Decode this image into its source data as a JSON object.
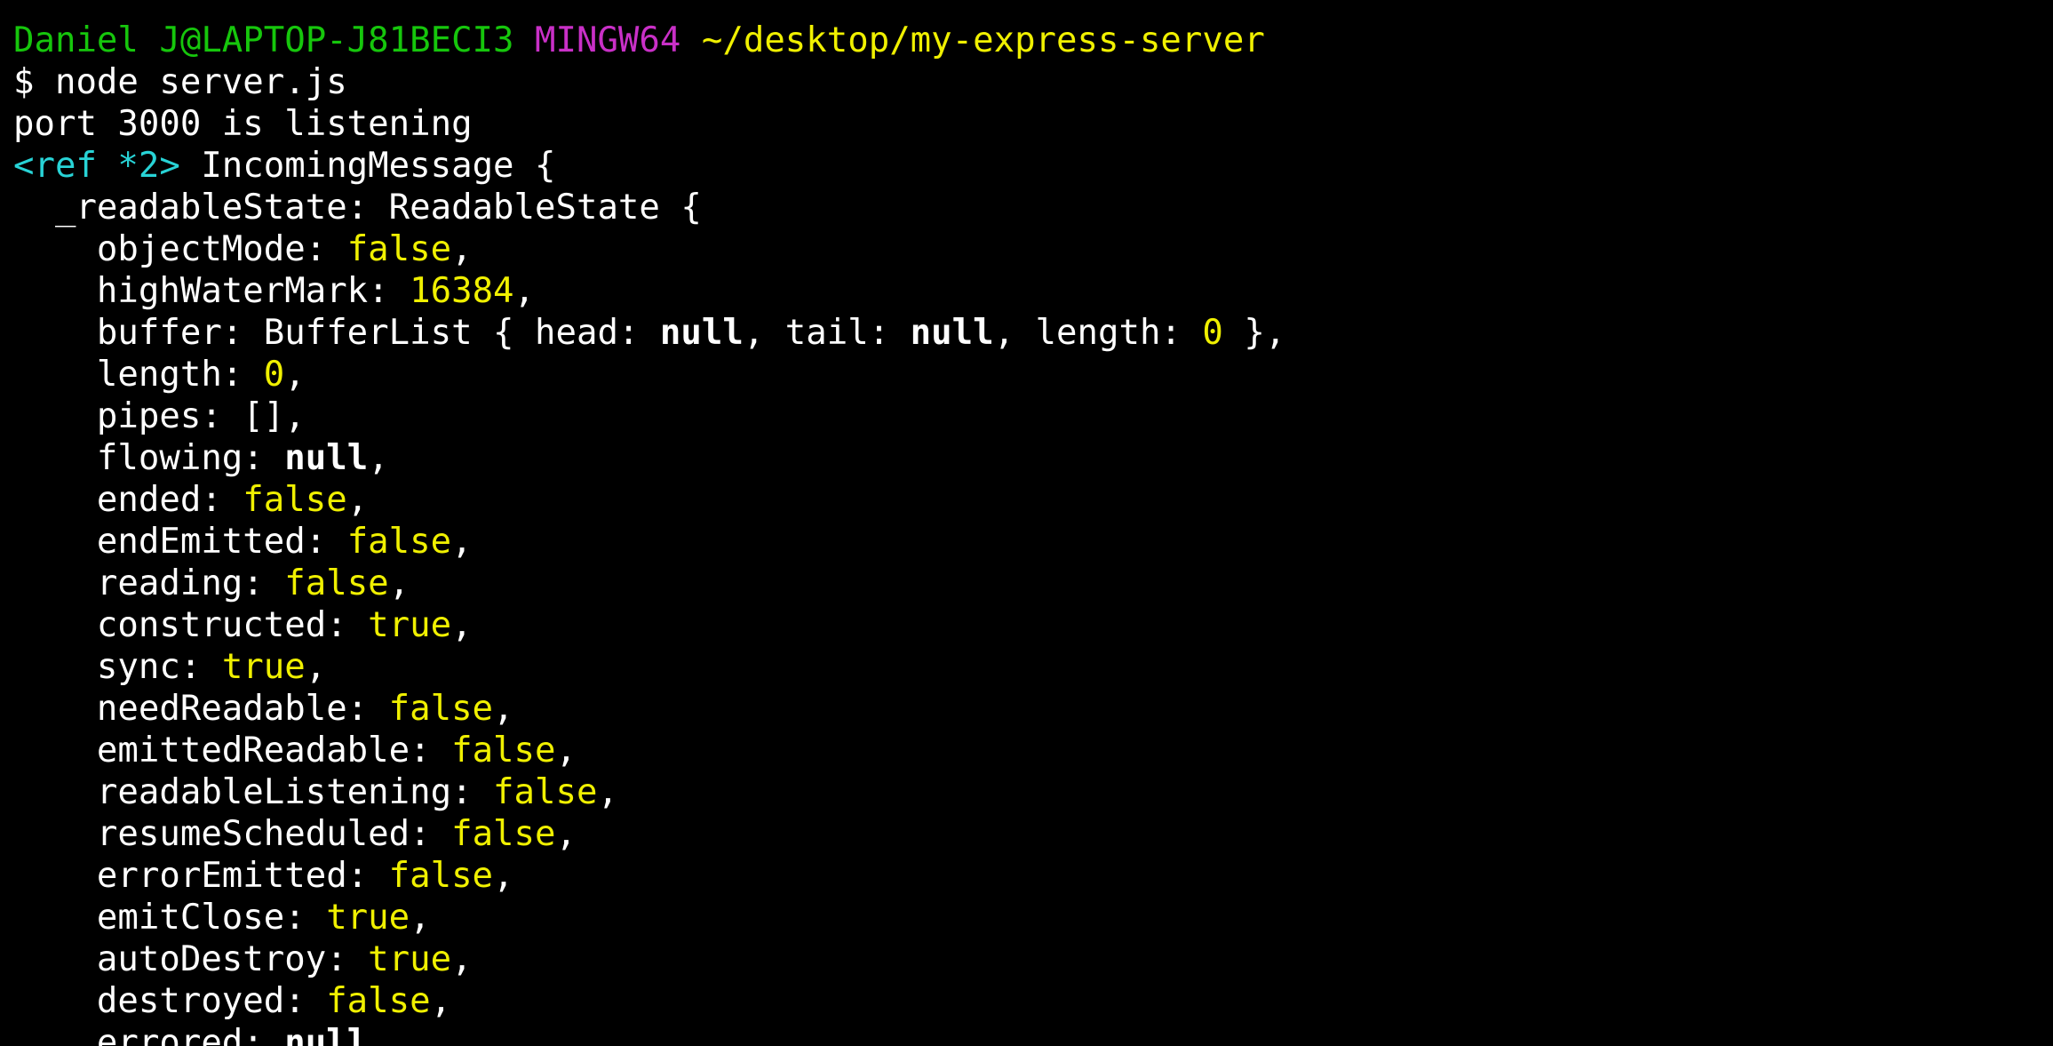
{
  "prompt": {
    "user": "Daniel J@LAPTOP-J81BECI3",
    "shell": "MINGW64",
    "path": "~/desktop/my-express-server"
  },
  "colors": {
    "background": "#000000",
    "text": "#ffffff",
    "user_host": "#16c60c",
    "shell": "#c930c7",
    "path": "#f0f000",
    "value": "#f0f000",
    "ref": "#28d3d6"
  },
  "lines": [
    [
      {
        "t": "Daniel J@LAPTOP-J81BECI3",
        "c": "green"
      },
      {
        "t": " "
      },
      {
        "t": "MINGW64",
        "c": "magenta"
      },
      {
        "t": " "
      },
      {
        "t": "~/desktop/my-express-server",
        "c": "yellow"
      }
    ],
    [
      {
        "t": "$ node server.js"
      }
    ],
    [
      {
        "t": "port 3000 is listening"
      }
    ],
    [
      {
        "t": "<ref *2>",
        "c": "cyan"
      },
      {
        "t": " IncomingMessage {"
      }
    ],
    [
      {
        "t": "  _readableState: ReadableState {"
      }
    ],
    [
      {
        "t": "    objectMode: "
      },
      {
        "t": "false",
        "c": "yellow"
      },
      {
        "t": ","
      }
    ],
    [
      {
        "t": "    highWaterMark: "
      },
      {
        "t": "16384",
        "c": "yellow"
      },
      {
        "t": ","
      }
    ],
    [
      {
        "t": "    buffer: BufferList { head: "
      },
      {
        "t": "null",
        "c": "bold"
      },
      {
        "t": ", tail: "
      },
      {
        "t": "null",
        "c": "bold"
      },
      {
        "t": ", length: "
      },
      {
        "t": "0",
        "c": "yellow"
      },
      {
        "t": " },"
      }
    ],
    [
      {
        "t": "    length: "
      },
      {
        "t": "0",
        "c": "yellow"
      },
      {
        "t": ","
      }
    ],
    [
      {
        "t": "    pipes: [],"
      }
    ],
    [
      {
        "t": "    flowing: "
      },
      {
        "t": "null",
        "c": "bold"
      },
      {
        "t": ","
      }
    ],
    [
      {
        "t": "    ended: "
      },
      {
        "t": "false",
        "c": "yellow"
      },
      {
        "t": ","
      }
    ],
    [
      {
        "t": "    endEmitted: "
      },
      {
        "t": "false",
        "c": "yellow"
      },
      {
        "t": ","
      }
    ],
    [
      {
        "t": "    reading: "
      },
      {
        "t": "false",
        "c": "yellow"
      },
      {
        "t": ","
      }
    ],
    [
      {
        "t": "    constructed: "
      },
      {
        "t": "true",
        "c": "yellow"
      },
      {
        "t": ","
      }
    ],
    [
      {
        "t": "    sync: "
      },
      {
        "t": "true",
        "c": "yellow"
      },
      {
        "t": ","
      }
    ],
    [
      {
        "t": "    needReadable: "
      },
      {
        "t": "false",
        "c": "yellow"
      },
      {
        "t": ","
      }
    ],
    [
      {
        "t": "    emittedReadable: "
      },
      {
        "t": "false",
        "c": "yellow"
      },
      {
        "t": ","
      }
    ],
    [
      {
        "t": "    readableListening: "
      },
      {
        "t": "false",
        "c": "yellow"
      },
      {
        "t": ","
      }
    ],
    [
      {
        "t": "    resumeScheduled: "
      },
      {
        "t": "false",
        "c": "yellow"
      },
      {
        "t": ","
      }
    ],
    [
      {
        "t": "    errorEmitted: "
      },
      {
        "t": "false",
        "c": "yellow"
      },
      {
        "t": ","
      }
    ],
    [
      {
        "t": "    emitClose: "
      },
      {
        "t": "true",
        "c": "yellow"
      },
      {
        "t": ","
      }
    ],
    [
      {
        "t": "    autoDestroy: "
      },
      {
        "t": "true",
        "c": "yellow"
      },
      {
        "t": ","
      }
    ],
    [
      {
        "t": "    destroyed: "
      },
      {
        "t": "false",
        "c": "yellow"
      },
      {
        "t": ","
      }
    ],
    [
      {
        "t": "    errored: "
      },
      {
        "t": "null",
        "c": "bold"
      },
      {
        "t": ","
      }
    ]
  ]
}
